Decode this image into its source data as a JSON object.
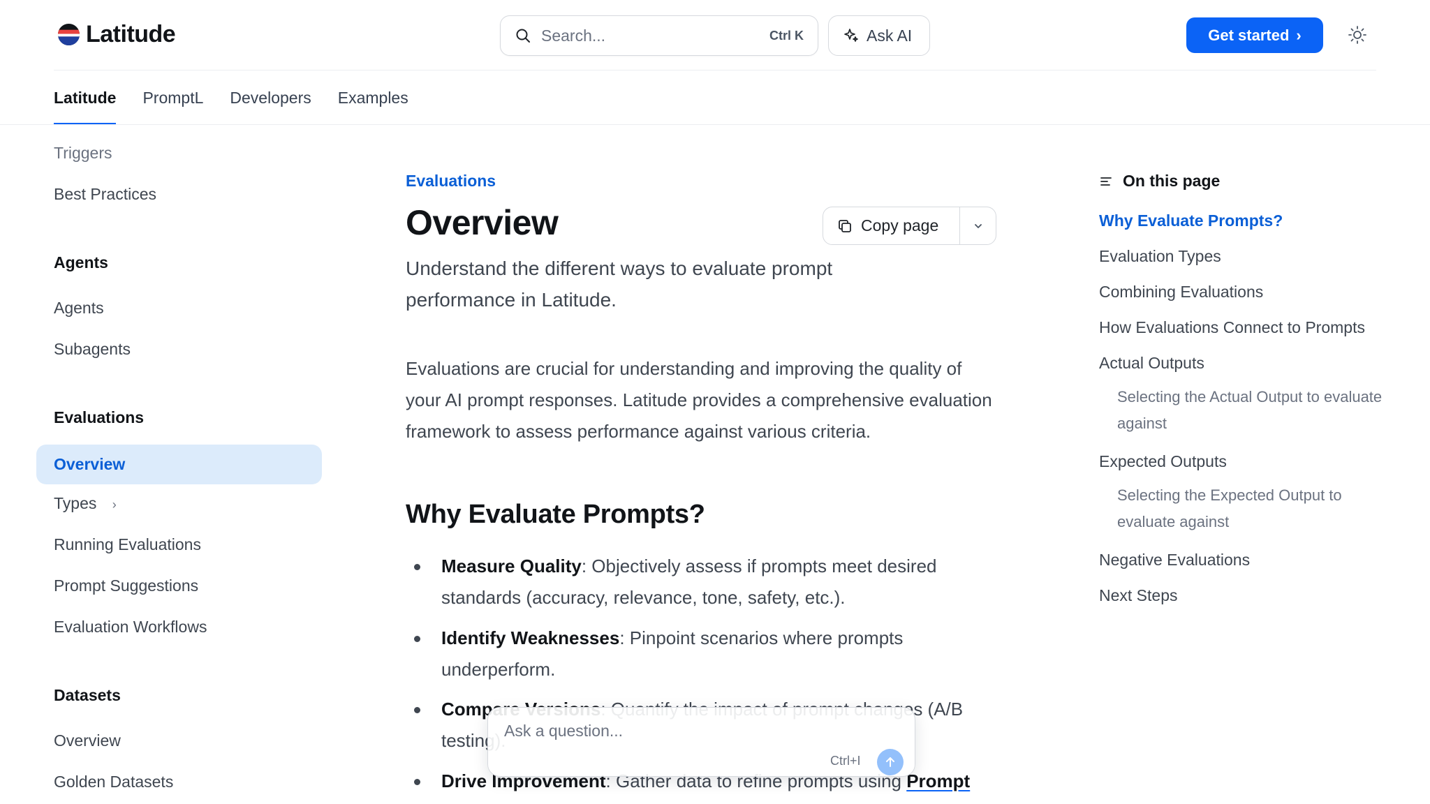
{
  "header": {
    "brand": "Latitude",
    "search_placeholder": "Search...",
    "search_shortcut": "Ctrl K",
    "ask_ai_label": "Ask AI",
    "cta_label": "Get started",
    "cta_chevron": "›"
  },
  "tabs": [
    {
      "label": "Latitude",
      "active": true
    },
    {
      "label": "PromptL"
    },
    {
      "label": "Developers"
    },
    {
      "label": "Examples"
    }
  ],
  "sidebar": {
    "items_top": [
      "Triggers",
      "Best Practices"
    ],
    "agents_heading": "Agents",
    "agents_items": [
      "Agents",
      "Subagents"
    ],
    "evaluations_heading": "Evaluations",
    "evaluations_active": "Overview",
    "evaluations_types": "Types",
    "evaluations_types_chevron": "›",
    "evaluations_items": [
      "Running Evaluations",
      "Prompt Suggestions",
      "Evaluation Workflows"
    ],
    "datasets_heading": "Datasets",
    "datasets_items": [
      "Overview",
      "Golden Datasets"
    ]
  },
  "main": {
    "eyebrow": "Evaluations",
    "title": "Overview",
    "copy_label": "Copy page",
    "subtitle": "Understand the different ways to evaluate prompt performance in Latitude.",
    "intro": "Evaluations are crucial for understanding and improving the quality of your AI prompt responses. Latitude provides a comprehensive evaluation framework to assess performance against various criteria.",
    "h2": "Why Evaluate Prompts?",
    "bullets": [
      {
        "bold": "Measure Quality",
        "text": ": Objectively assess if prompts meet desired standards (accuracy, relevance, tone, safety, etc.)."
      },
      {
        "bold": "Identify Weaknesses",
        "text": ": Pinpoint scenarios where prompts underperform."
      },
      {
        "bold": "Compare Versions",
        "text": ": Quantify the impact of prompt changes (A/B testing)."
      },
      {
        "bold": "Drive Improvement",
        "text": ": Gather data to refine prompts using ",
        "link": "Prompt"
      }
    ]
  },
  "askbox": {
    "placeholder": "Ask a question...",
    "shortcut": "Ctrl+I"
  },
  "toc": {
    "heading": "On this page",
    "items": [
      {
        "label": "Why Evaluate Prompts?",
        "active": true
      },
      {
        "label": "Evaluation Types"
      },
      {
        "label": "Combining Evaluations"
      },
      {
        "label": "How Evaluations Connect to Prompts"
      },
      {
        "label": "Actual Outputs"
      },
      {
        "label": "Selecting the Actual Output to evaluate against",
        "sub": true
      },
      {
        "label": "Expected Outputs"
      },
      {
        "label": "Selecting the Expected Output to evaluate against",
        "sub": true
      },
      {
        "label": "Negative Evaluations"
      },
      {
        "label": "Next Steps"
      }
    ]
  },
  "colors": {
    "accent": "#0b63f6",
    "accent_text": "#0b5fd6",
    "active_bg": "#dcebfb"
  }
}
